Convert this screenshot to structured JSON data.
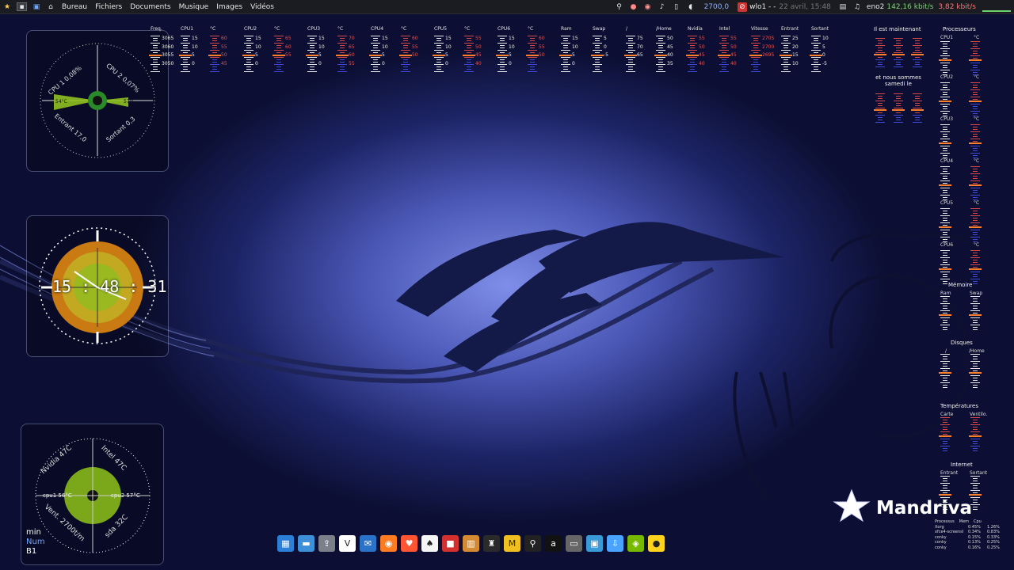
{
  "panel": {
    "menus": [
      "Bureau",
      "Fichiers",
      "Documents",
      "Musique",
      "Images",
      "Vidéos"
    ],
    "cpu_freq": "2700,0",
    "wifi_label": "wlo1 - -",
    "date_time": "22 avril, 15:48",
    "eth_label": "eno2",
    "net_up": "142,16 kbit/s",
    "net_down": "3,82 kbit/s"
  },
  "gauge_cpu": {
    "cpu1": "CPU 1 0,08%",
    "cpu2": "CPU 2 0,07%",
    "left_temp": "54°C",
    "right_temp": "57°C",
    "in": "Entrant 17,0",
    "out": "Sortant 0,3"
  },
  "clock": {
    "time": "15 : 48 : 31"
  },
  "gauge_temp": {
    "nvidia": "Nvidia 47C",
    "intel": "Intel 47C",
    "cpu1": "cpu1 56°C",
    "cpu2": "cpu2 57°C",
    "vent": "Vent. 2700t/m",
    "sda": "sda 32C"
  },
  "top_columns": [
    {
      "label": "Freq.",
      "vals": [
        "3065",
        "3060",
        "3055",
        "3050"
      ]
    },
    {
      "label": "CPU1",
      "vals": [
        "15",
        "10",
        "5",
        "0"
      ]
    },
    {
      "label": "°C",
      "vals": [
        "60",
        "55",
        "50",
        "45"
      ],
      "red": true
    },
    {
      "label": "CPU2",
      "vals": [
        "15",
        "10",
        "5",
        "0"
      ]
    },
    {
      "label": "°C",
      "vals": [
        "65",
        "60",
        "55"
      ],
      "red": true
    },
    {
      "label": "CPU3",
      "vals": [
        "15",
        "10",
        "5",
        "0"
      ]
    },
    {
      "label": "°C",
      "vals": [
        "70",
        "65",
        "60",
        "55"
      ],
      "red": true
    },
    {
      "label": "CPU4",
      "vals": [
        "15",
        "10",
        "5",
        "0"
      ]
    },
    {
      "label": "°C",
      "vals": [
        "60",
        "55",
        "50"
      ],
      "red": true
    },
    {
      "label": "CPU5",
      "vals": [
        "15",
        "10",
        "5",
        "0"
      ]
    },
    {
      "label": "°C",
      "vals": [
        "55",
        "50",
        "45",
        "40"
      ],
      "red": true
    },
    {
      "label": "CPU6",
      "vals": [
        "15",
        "10",
        "5",
        "0"
      ]
    },
    {
      "label": "°C",
      "vals": [
        "60",
        "55",
        "50"
      ],
      "red": true
    },
    {
      "label": "Ram",
      "vals": [
        "15",
        "10",
        "5",
        "0"
      ]
    },
    {
      "label": "Swap",
      "vals": [
        "5",
        "0",
        "-5"
      ]
    },
    {
      "label": "/",
      "vals": [
        "75",
        "70",
        "65"
      ]
    },
    {
      "label": "/Home",
      "vals": [
        "50",
        "45",
        "40",
        "35"
      ]
    },
    {
      "label": "Nvidia",
      "vals": [
        "55",
        "50",
        "45",
        "40"
      ],
      "red": true
    },
    {
      "label": "Intel",
      "vals": [
        "55",
        "50",
        "45",
        "40"
      ],
      "red": true
    },
    {
      "label": "Vitesse",
      "vals": [
        "2705",
        "2700",
        "2695"
      ],
      "red": true
    },
    {
      "label": "Entrant",
      "vals": [
        "25",
        "20",
        "15",
        "10"
      ]
    },
    {
      "label": "Sortant",
      "vals": [
        "10",
        "5",
        "0",
        "-5"
      ]
    }
  ],
  "right": {
    "title_time": "Il est maintenant",
    "title_date": "et nous sommes samedi le",
    "time_vals": [
      "20",
      "15",
      "10",
      "50",
      "45",
      "35",
      "30",
      "25"
    ],
    "date_vals": [
      "25",
      "20",
      "15",
      "10",
      "5",
      "0",
      "2025",
      "2020"
    ],
    "processors": "Processeurs",
    "cpu_labels": [
      "CPU1",
      "CPU2",
      "CPU3",
      "CPU4",
      "CPU5",
      "CPU6"
    ],
    "deg": "°C",
    "memory": "Mémoire",
    "ram": "Ram",
    "swap": "Swap",
    "disks": "Disques",
    "root": "/",
    "home": "/Home",
    "temps": "Températures",
    "carte": "Carte",
    "ventilo": "Ventilo.",
    "internet": "Internet",
    "entrant": "Entrant",
    "sortant": "Sortant",
    "proc_header": [
      "Processus",
      "Mem",
      "Cpu"
    ],
    "proc_rows": [
      [
        "Xorg",
        "0.45%",
        "1.26%"
      ],
      [
        "xfce4-screensho",
        "0.34%",
        "0.83%"
      ],
      [
        "conky",
        "0.15%",
        "0.33%"
      ],
      [
        "conky",
        "0.13%",
        "0.25%"
      ],
      [
        "conky",
        "0.16%",
        "0.25%"
      ]
    ]
  },
  "keys": {
    "min": "min",
    "num": "Num",
    "b1": "B1"
  },
  "brand": "Mandriva",
  "dock_icons": [
    "window-manager-icon",
    "show-desktop-icon",
    "monitor-upload-icon",
    "vivaldi-icon",
    "thunderbird-icon",
    "firefox-icon",
    "brave-icon",
    "cards-game-icon",
    "red-cube-game-icon",
    "mahjong-icon",
    "chess-icon",
    "money-manager-icon",
    "network-antenna-icon",
    "a-icon",
    "scanner-icon",
    "screen-capture-icon",
    "download-icon",
    "nvidia-icon",
    "sun-icon"
  ],
  "colors": {
    "accent": "#ff7f2a",
    "red_scale": "#d34848",
    "blue_scale": "#3f4ad6"
  }
}
